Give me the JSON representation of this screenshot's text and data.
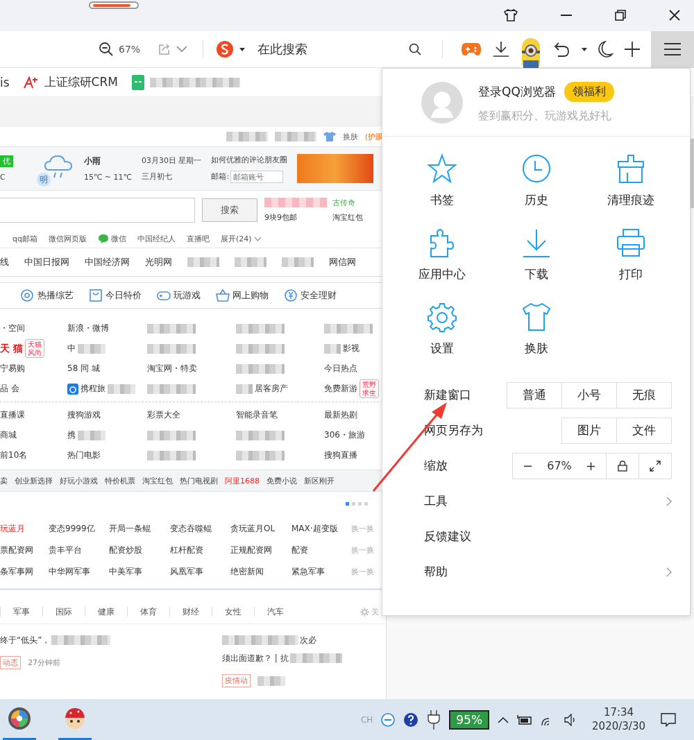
{
  "toolbar": {
    "zoom": "67%",
    "search_placeholder": "在此搜索"
  },
  "bookmarks": [
    {
      "kind": "text",
      "label": "is"
    },
    {
      "kind": "aplus",
      "label": "上证综研CRM"
    },
    {
      "kind": "sheet"
    }
  ],
  "page": {
    "top_links": [
      {
        "kind": "blur"
      },
      {
        "kind": "blur"
      },
      {
        "kind": "skin",
        "label": "换肤"
      },
      {
        "kind": "eye",
        "label": "(护眼"
      }
    ],
    "weather": {
      "aqi": "优",
      "temp_cut": "C",
      "tomorrow": "明",
      "condition": "小雨",
      "range": "15℃ ~ 11℃",
      "date": "03月30日 星期一",
      "lunar": "三月初七",
      "headline": "如何优雅的评论朋友圈",
      "mail_label": "邮箱:",
      "mail_placeholder": "邮箱账号"
    },
    "search": {
      "button": "搜索",
      "promos": [
        {
          "kind": "blur"
        },
        {
          "kind": "green",
          "label": "古传奇"
        },
        {
          "kind": "text",
          "label": "9块9包邮"
        },
        {
          "kind": "text",
          "label": "淘宝红包"
        }
      ]
    },
    "quick_links": [
      {
        "kind": "text",
        "label": "qq邮箱"
      },
      {
        "kind": "text",
        "label": "微信网页版"
      },
      {
        "kind": "wechat",
        "label": "微信"
      },
      {
        "kind": "text",
        "label": "中国经纪人"
      },
      {
        "kind": "text",
        "label": "直播吧"
      },
      {
        "kind": "expand",
        "label": "展开(24)"
      }
    ],
    "sites": [
      {
        "kind": "text",
        "label": "线"
      },
      {
        "kind": "text",
        "label": "中国日报网"
      },
      {
        "kind": "text",
        "label": "中国经济网"
      },
      {
        "kind": "text",
        "label": "光明网"
      },
      {
        "kind": "blur"
      },
      {
        "kind": "blur"
      },
      {
        "kind": "blur"
      },
      {
        "kind": "text",
        "label": "网信网"
      }
    ],
    "categories": [
      "热播综艺",
      "今日特价",
      "玩游戏",
      "网上购物",
      "安全理财"
    ],
    "grid_top": [
      [
        {
          "kind": "link",
          "label": "・空间"
        },
        {
          "kind": "link",
          "label": "新浪・微博"
        },
        {
          "kind": "blur"
        },
        {
          "kind": "blur"
        },
        {
          "kind": "blur"
        }
      ],
      [
        {
          "kind": "hot",
          "label": "天 猫",
          "tag": "天猫风尚"
        },
        {
          "kind": "link-blur",
          "label": "中"
        },
        {
          "kind": "blur"
        },
        {
          "kind": "blur"
        },
        {
          "kind": "blur-link",
          "label": "影视"
        }
      ],
      [
        {
          "kind": "link",
          "label": "宁易购"
        },
        {
          "kind": "link",
          "label": "58 同 城"
        },
        {
          "kind": "link",
          "label": "淘宝网・特卖"
        },
        {
          "kind": "blur"
        },
        {
          "kind": "link",
          "label": "今日热点"
        }
      ],
      [
        {
          "kind": "link",
          "label": "品 会"
        },
        {
          "kind": "app-link-blur",
          "label": "携程旅"
        },
        {
          "kind": "blur"
        },
        {
          "kind": "blur-link",
          "label": "居客房产"
        },
        {
          "kind": "link",
          "label": "免费新游",
          "tag": "荒野求生"
        }
      ]
    ],
    "grid_bottom": [
      [
        {
          "kind": "link",
          "label": "直播课"
        },
        {
          "kind": "link",
          "label": "搜狗游戏"
        },
        {
          "kind": "link",
          "label": "彩票大全"
        },
        {
          "kind": "link",
          "label": "智能录音笔"
        },
        {
          "kind": "link",
          "label": "最新热剧"
        }
      ],
      [
        {
          "kind": "link",
          "label": "商城"
        },
        {
          "kind": "link-blur",
          "label": "携"
        },
        {
          "kind": "blur"
        },
        {
          "kind": "blur"
        },
        {
          "kind": "link",
          "label": "306・旅游"
        }
      ],
      [
        {
          "kind": "link",
          "label": "前10名"
        },
        {
          "kind": "link",
          "label": "热门电影"
        },
        {
          "kind": "blur"
        },
        {
          "kind": "blur"
        },
        {
          "kind": "link",
          "label": "搜狗直播"
        }
      ]
    ],
    "hot_strip": [
      {
        "label": "卖",
        "hot": false
      },
      {
        "label": "创业新选择",
        "hot": false
      },
      {
        "label": "好玩小游戏",
        "hot": false
      },
      {
        "label": "特价机票",
        "hot": false
      },
      {
        "label": "淘宝红包",
        "hot": false
      },
      {
        "label": "热门电视剧",
        "hot": false
      },
      {
        "label": "阿里1688",
        "hot": true
      },
      {
        "label": "免费小说",
        "hot": false
      },
      {
        "label": "新区刚开",
        "hot": false
      }
    ],
    "pager": [
      {
        "selected": true
      },
      {
        "selected": false
      },
      {
        "selected": false
      },
      {
        "selected": false
      }
    ],
    "games": [
      {
        "cells": [
          {
            "label": "玩蓝月",
            "hot": true
          },
          {
            "label": "变态9999亿",
            "hot": false
          },
          {
            "label": "开局一条鲲",
            "hot": false
          },
          {
            "label": "变态吞噬鲲",
            "hot": false
          },
          {
            "label": "贪玩蓝月OL",
            "hot": false
          },
          {
            "label": "MAX·超变版",
            "hot": false
          }
        ],
        "refresh": "换一换"
      },
      {
        "cells": [
          {
            "label": "票配资网",
            "hot": false
          },
          {
            "label": "贵丰平台",
            "hot": false
          },
          {
            "label": "配资炒股",
            "hot": false
          },
          {
            "label": "杠杆配资",
            "hot": false
          },
          {
            "label": "正规配资网",
            "hot": false
          },
          {
            "label": "配资",
            "hot": false
          }
        ],
        "refresh": "换一换"
      },
      {
        "cells": [
          {
            "label": "条军事网",
            "hot": false
          },
          {
            "label": "中华网军事",
            "hot": false
          },
          {
            "label": "中美军事",
            "hot": false
          },
          {
            "label": "风凰军事",
            "hot": false
          },
          {
            "label": "绝密新闻",
            "hot": false
          },
          {
            "label": "紧急军事",
            "hot": false
          }
        ],
        "refresh": "换一换"
      }
    ],
    "news_tabs": [
      "军事",
      "国际",
      "健康",
      "体育",
      "财经",
      "女性",
      "汽车"
    ],
    "news_settings": "关",
    "news": [
      {
        "title": "终于“低头”，",
        "tag": "动态",
        "time": "27分钟前"
      },
      {
        "title": "次必",
        "title2": "须出面道歉？ | 抗",
        "tag": "疫情动"
      }
    ]
  },
  "menu": {
    "login": "登录QQ浏览器",
    "bonus": "领福利",
    "subtitle": "签到赢积分、玩游戏兑好礼",
    "tiles": [
      "书签",
      "历史",
      "清理痕迹",
      "应用中心",
      "下载",
      "打印",
      "设置",
      "换肤"
    ],
    "rows": [
      {
        "kind": "buttons",
        "label": "新建窗口",
        "buttons": [
          "普通",
          "小号",
          "无痕"
        ]
      },
      {
        "kind": "buttons",
        "label": "网页另存为",
        "buttons": [
          "图片",
          "文件"
        ]
      },
      {
        "kind": "zoom",
        "label": "缩放",
        "minus": "−",
        "value": "67%",
        "plus": "+"
      },
      {
        "kind": "submenu",
        "label": "工具"
      },
      {
        "kind": "plain",
        "label": "反馈建议"
      },
      {
        "kind": "submenu",
        "label": "帮助"
      }
    ]
  },
  "taskbar": {
    "ime": "CH",
    "battery": "95%",
    "time": "17:34",
    "date": "2020/3/30"
  }
}
